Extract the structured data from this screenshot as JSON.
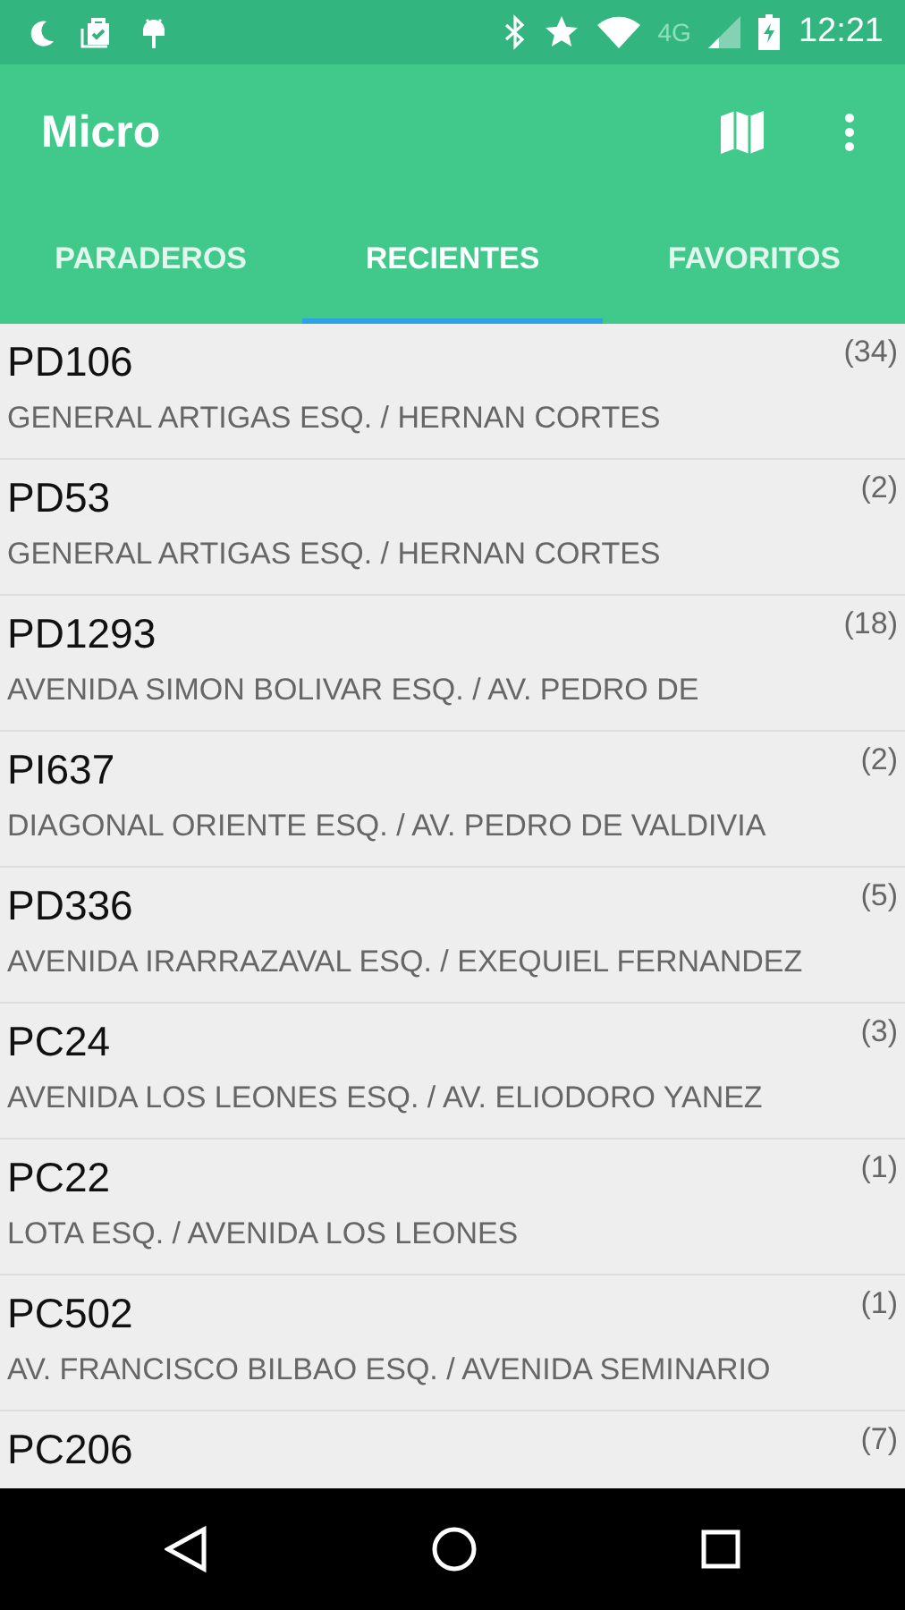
{
  "status_bar": {
    "network": "4G",
    "time": "12:21"
  },
  "app_bar": {
    "title": "Micro"
  },
  "tabs": [
    {
      "label": "PARADEROS",
      "selected": false
    },
    {
      "label": "RECIENTES",
      "selected": true
    },
    {
      "label": "FAVORITOS",
      "selected": false
    }
  ],
  "stops": [
    {
      "code": "PD106",
      "count": "(34)",
      "address": "GENERAL ARTIGAS ESQ. / HERNAN CORTES"
    },
    {
      "code": "PD53",
      "count": "(2)",
      "address": "GENERAL ARTIGAS ESQ. / HERNAN CORTES"
    },
    {
      "code": "PD1293",
      "count": "(18)",
      "address": "AVENIDA SIMON BOLIVAR ESQ. / AV. PEDRO DE"
    },
    {
      "code": "PI637",
      "count": "(2)",
      "address": "DIAGONAL ORIENTE ESQ. / AV. PEDRO DE VALDIVIA"
    },
    {
      "code": "PD336",
      "count": "(5)",
      "address": "AVENIDA IRARRAZAVAL ESQ. / EXEQUIEL FERNANDEZ"
    },
    {
      "code": "PC24",
      "count": "(3)",
      "address": "AVENIDA LOS LEONES ESQ. / AV. ELIODORO YANEZ"
    },
    {
      "code": "PC22",
      "count": "(1)",
      "address": "LOTA ESQ. / AVENIDA LOS LEONES"
    },
    {
      "code": "PC502",
      "count": "(1)",
      "address": "AV. FRANCISCO BILBAO ESQ. / AVENIDA SEMINARIO"
    },
    {
      "code": "PC206",
      "count": "(7)"
    }
  ]
}
